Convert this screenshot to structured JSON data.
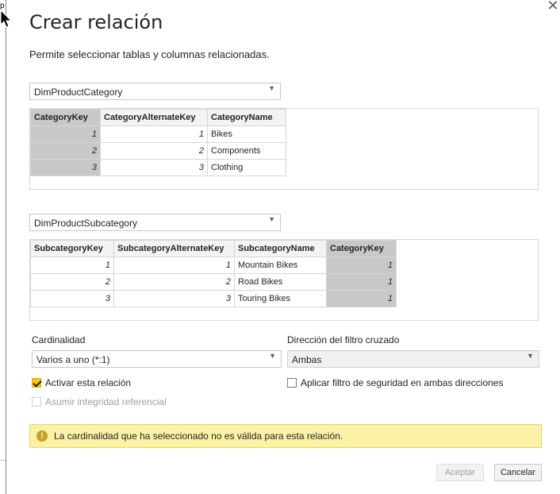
{
  "background": {
    "letter": "p",
    "dots": "..."
  },
  "dialog": {
    "title": "Crear relación",
    "subtitle": "Permite seleccionar tablas y columnas relacionadas.",
    "close_glyph": "✕"
  },
  "table1": {
    "name": "DimProductCategory",
    "columns": [
      "CategoryKey",
      "CategoryAlternateKey",
      "CategoryName"
    ],
    "rows": [
      [
        "1",
        "1",
        "Bikes"
      ],
      [
        "2",
        "2",
        "Components"
      ],
      [
        "3",
        "3",
        "Clothing"
      ]
    ]
  },
  "table2": {
    "name": "DimProductSubcategory",
    "columns": [
      "SubcategoryKey",
      "SubcategoryAlternateKey",
      "SubcategoryName",
      "CategoryKey"
    ],
    "rows": [
      [
        "1",
        "1",
        "Mountain Bikes",
        "1"
      ],
      [
        "2",
        "2",
        "Road Bikes",
        "1"
      ],
      [
        "3",
        "3",
        "Touring Bikes",
        "1"
      ]
    ]
  },
  "cardinality": {
    "label": "Cardinalidad",
    "value": "Varios a uno (*:1)"
  },
  "crossfilter": {
    "label": "Dirección del filtro cruzado",
    "value": "Ambas"
  },
  "options": {
    "activate": {
      "label": "Activar esta relación",
      "checked": true
    },
    "security": {
      "label": "Aplicar filtro de seguridad en ambas direcciones",
      "checked": false
    },
    "referential": {
      "label": "Asumir integridad referencial",
      "checked": false,
      "disabled": true
    }
  },
  "warning": {
    "icon": "warning-icon",
    "icon_glyph": "!",
    "text": "La cardinalidad que ha seleccionado no es válida para esta relación."
  },
  "buttons": {
    "ok": "Aceptar",
    "cancel": "Cancelar"
  },
  "colors": {
    "accent": "#f2c811",
    "warning_bg": "#fbf2a6",
    "selected_column": "#c8c8c8"
  }
}
